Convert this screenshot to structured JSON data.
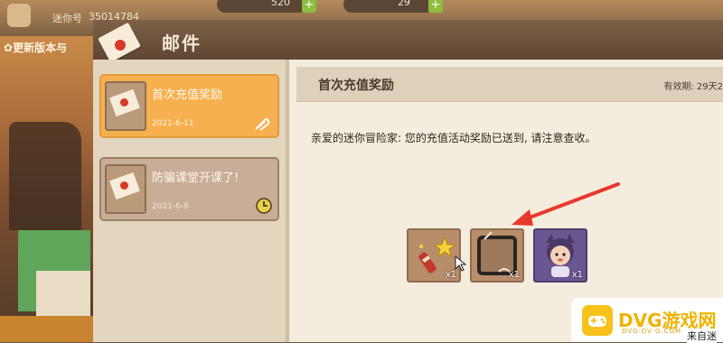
{
  "hud": {
    "player_id_label": "迷你号",
    "player_id": "35014784",
    "currency_a": "520",
    "currency_b": "29",
    "update_banner": "更新版本与"
  },
  "window": {
    "title": "邮件"
  },
  "mails": [
    {
      "title": "首次充值奖励",
      "date": "2021-6-11",
      "state": "selected",
      "badge": "attachment"
    },
    {
      "title": "防骗课堂开课了!",
      "date": "2021-6-8",
      "state": "normal",
      "badge": "clock"
    }
  ],
  "detail": {
    "title": "首次充值奖励",
    "validity": "有效期: 29天2",
    "body": "亲爱的迷你冒险家: 您的充值活动奖励已送到, 请注意查收。",
    "rewards": [
      {
        "name": "firework-stick",
        "count": "x1"
      },
      {
        "name": "avatar-frame",
        "count": "x1"
      },
      {
        "name": "cat-costume-skin",
        "count": "x1"
      }
    ]
  },
  "watermark": {
    "brand": "DVG游戏网",
    "sub": "DVG·DV·G.COM",
    "footer": "来自迷"
  },
  "colors": {
    "accent_selected": "#f7b04f",
    "titlebar": "#6d523d",
    "arrow": "#e8372c"
  }
}
